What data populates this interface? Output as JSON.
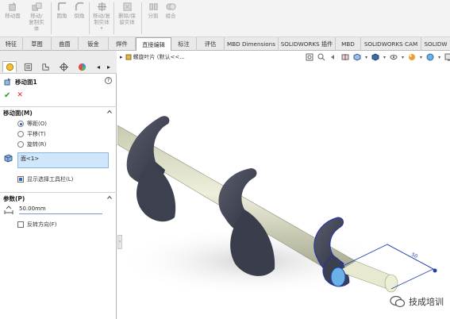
{
  "ribbon": {
    "buttons": [
      {
        "label_lines": [
          "移动面"
        ],
        "icon": "move-face-icon"
      },
      {
        "label_lines": [
          "移动/",
          "复制实",
          "体"
        ],
        "icon": "move-copy-body-icon"
      },
      {
        "label_lines": [
          "圆角"
        ],
        "icon": "fillet-icon"
      },
      {
        "label_lines": [
          "倒角"
        ],
        "icon": "chamfer-icon"
      },
      {
        "label_lines": [
          "移动/复",
          "制实体"
        ],
        "icon": "move-copy-solid-icon"
      },
      {
        "label_lines": [
          "删除/保",
          "留实体"
        ],
        "icon": "delete-keep-body-icon"
      },
      {
        "label_lines": [
          "分割"
        ],
        "icon": "split-icon"
      },
      {
        "label_lines": [
          "组合"
        ],
        "icon": "combine-icon"
      }
    ]
  },
  "tabs": [
    "特征",
    "草图",
    "曲面",
    "钣金",
    "焊件",
    "直接编辑",
    "标注",
    "评估",
    "MBD Dimensions",
    "SOLIDWORKS 插件",
    "MBD",
    "SOLIDWORKS CAM",
    "SOLIDW"
  ],
  "active_tab": "直接编辑",
  "panel": {
    "title": "移动面1",
    "help": "?",
    "ok": "✔",
    "cancel": "✕",
    "section_move": "移动面(M)",
    "options": [
      "等距(O)",
      "平移(T)",
      "旋转(R)"
    ],
    "selected_option": "等距(O)",
    "face_selection": "面<1>",
    "show_toolbar": "显示选择工具栏(L)",
    "section_params": "参数(P)",
    "distance": "50.00mm",
    "reverse": "反转方向(F)"
  },
  "viewport": {
    "breadcrumb": "螺旋叶片 (默认<<...",
    "dimension_label": "50",
    "watermark": "技成培训"
  },
  "colors": {
    "accent": "#1a58c4",
    "selection_fill": "#cfe6fb",
    "shaft": "#e2e4c8",
    "flight": "#4a4d5a"
  }
}
